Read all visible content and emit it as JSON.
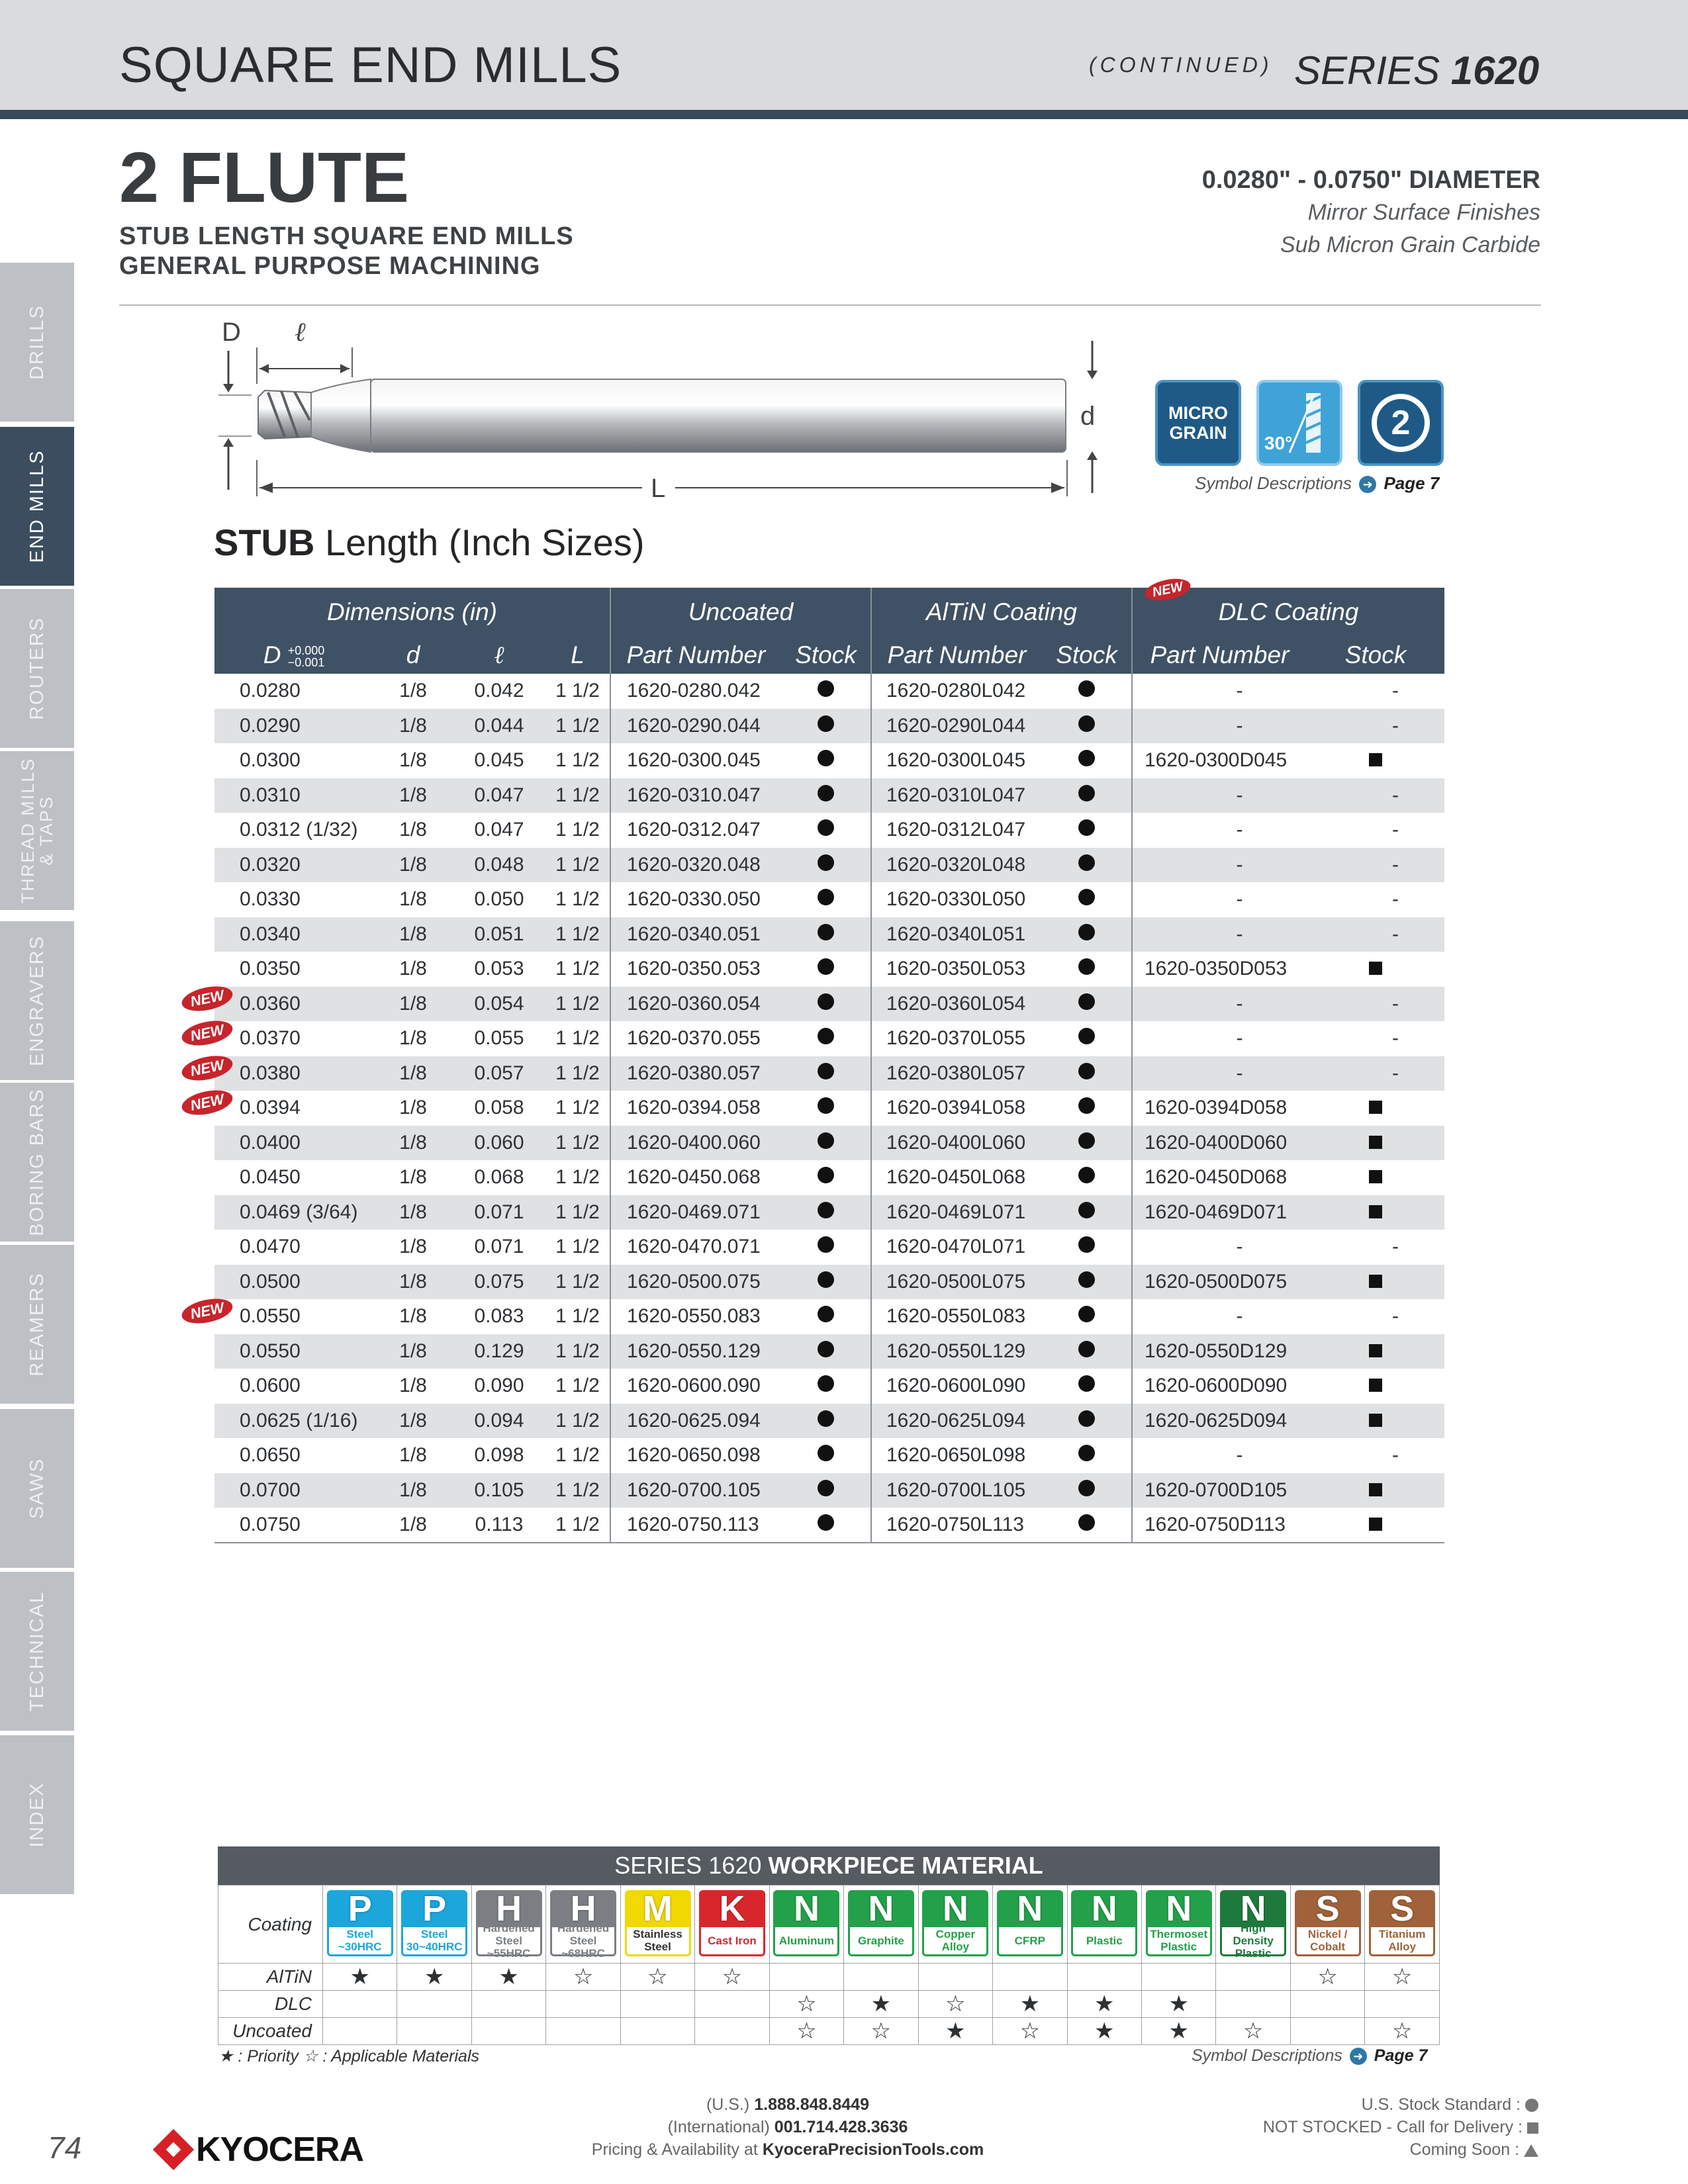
{
  "header": {
    "title": "SQUARE END MILLS",
    "continued": "(CONTINUED)",
    "series_prefix": "SERIES",
    "series_num": "1620"
  },
  "sidebar": [
    "DRILLS",
    "END MILLS",
    "ROUTERS",
    "THREAD MILLS & TAPS",
    "ENGRAVERS",
    "BORING BARS",
    "REAMERS",
    "SAWS",
    "TECHNICAL",
    "INDEX"
  ],
  "intro": {
    "flute": "2 FLUTE",
    "sub1": "STUB LENGTH SQUARE END MILLS",
    "sub2": "GENERAL PURPOSE MACHINING",
    "diameter": "0.0280\" - 0.0750\" DIAMETER",
    "finish1": "Mirror Surface Finishes",
    "finish2": "Sub Micron Grain Carbide"
  },
  "drawing": {
    "D": "D",
    "l": "ℓ",
    "d": "d",
    "L": "L"
  },
  "symbols": {
    "micro1": "MICRO",
    "micro2": "GRAIN",
    "helix": "30°",
    "flutes": "2",
    "caption": "Symbol Descriptions",
    "page": "Page 7"
  },
  "table": {
    "title_bold": "STUB",
    "title_rest": " Length (Inch Sizes)",
    "groups": {
      "dims": "Dimensions (in)",
      "uncoated": "Uncoated",
      "altin": "AlTiN Coating",
      "dlc": "DLC Coating",
      "new": "NEW"
    },
    "cols": {
      "D": "D",
      "tol_plus": "+0.000",
      "tol_minus": "−0.001",
      "d": "d",
      "l": "ℓ",
      "L": "L",
      "pn": "Part Number",
      "stock": "Stock"
    },
    "rows": [
      {
        "new": false,
        "D": "0.0280",
        "d": "1/8",
        "l": "0.042",
        "L": "1 1/2",
        "u": "1620-0280.042",
        "a": "1620-0280L042",
        "dl": "-"
      },
      {
        "new": false,
        "D": "0.0290",
        "d": "1/8",
        "l": "0.044",
        "L": "1 1/2",
        "u": "1620-0290.044",
        "a": "1620-0290L044",
        "dl": "-"
      },
      {
        "new": false,
        "D": "0.0300",
        "d": "1/8",
        "l": "0.045",
        "L": "1 1/2",
        "u": "1620-0300.045",
        "a": "1620-0300L045",
        "dl": "1620-0300D045"
      },
      {
        "new": false,
        "D": "0.0310",
        "d": "1/8",
        "l": "0.047",
        "L": "1 1/2",
        "u": "1620-0310.047",
        "a": "1620-0310L047",
        "dl": "-"
      },
      {
        "new": false,
        "D": "0.0312 (1/32)",
        "d": "1/8",
        "l": "0.047",
        "L": "1 1/2",
        "u": "1620-0312.047",
        "a": "1620-0312L047",
        "dl": "-"
      },
      {
        "new": false,
        "D": "0.0320",
        "d": "1/8",
        "l": "0.048",
        "L": "1 1/2",
        "u": "1620-0320.048",
        "a": "1620-0320L048",
        "dl": "-"
      },
      {
        "new": false,
        "D": "0.0330",
        "d": "1/8",
        "l": "0.050",
        "L": "1 1/2",
        "u": "1620-0330.050",
        "a": "1620-0330L050",
        "dl": "-"
      },
      {
        "new": false,
        "D": "0.0340",
        "d": "1/8",
        "l": "0.051",
        "L": "1 1/2",
        "u": "1620-0340.051",
        "a": "1620-0340L051",
        "dl": "-"
      },
      {
        "new": false,
        "D": "0.0350",
        "d": "1/8",
        "l": "0.053",
        "L": "1 1/2",
        "u": "1620-0350.053",
        "a": "1620-0350L053",
        "dl": "1620-0350D053"
      },
      {
        "new": true,
        "D": "0.0360",
        "d": "1/8",
        "l": "0.054",
        "L": "1 1/2",
        "u": "1620-0360.054",
        "a": "1620-0360L054",
        "dl": "-"
      },
      {
        "new": true,
        "D": "0.0370",
        "d": "1/8",
        "l": "0.055",
        "L": "1 1/2",
        "u": "1620-0370.055",
        "a": "1620-0370L055",
        "dl": "-"
      },
      {
        "new": true,
        "D": "0.0380",
        "d": "1/8",
        "l": "0.057",
        "L": "1 1/2",
        "u": "1620-0380.057",
        "a": "1620-0380L057",
        "dl": "-"
      },
      {
        "new": true,
        "D": "0.0394",
        "d": "1/8",
        "l": "0.058",
        "L": "1 1/2",
        "u": "1620-0394.058",
        "a": "1620-0394L058",
        "dl": "1620-0394D058"
      },
      {
        "new": false,
        "D": "0.0400",
        "d": "1/8",
        "l": "0.060",
        "L": "1 1/2",
        "u": "1620-0400.060",
        "a": "1620-0400L060",
        "dl": "1620-0400D060"
      },
      {
        "new": false,
        "D": "0.0450",
        "d": "1/8",
        "l": "0.068",
        "L": "1 1/2",
        "u": "1620-0450.068",
        "a": "1620-0450L068",
        "dl": "1620-0450D068"
      },
      {
        "new": false,
        "D": "0.0469 (3/64)",
        "d": "1/8",
        "l": "0.071",
        "L": "1 1/2",
        "u": "1620-0469.071",
        "a": "1620-0469L071",
        "dl": "1620-0469D071"
      },
      {
        "new": false,
        "D": "0.0470",
        "d": "1/8",
        "l": "0.071",
        "L": "1 1/2",
        "u": "1620-0470.071",
        "a": "1620-0470L071",
        "dl": "-"
      },
      {
        "new": false,
        "D": "0.0500",
        "d": "1/8",
        "l": "0.075",
        "L": "1 1/2",
        "u": "1620-0500.075",
        "a": "1620-0500L075",
        "dl": "1620-0500D075"
      },
      {
        "new": true,
        "D": "0.0550",
        "d": "1/8",
        "l": "0.083",
        "L": "1 1/2",
        "u": "1620-0550.083",
        "a": "1620-0550L083",
        "dl": "-"
      },
      {
        "new": false,
        "D": "0.0550",
        "d": "1/8",
        "l": "0.129",
        "L": "1 1/2",
        "u": "1620-0550.129",
        "a": "1620-0550L129",
        "dl": "1620-0550D129"
      },
      {
        "new": false,
        "D": "0.0600",
        "d": "1/8",
        "l": "0.090",
        "L": "1 1/2",
        "u": "1620-0600.090",
        "a": "1620-0600L090",
        "dl": "1620-0600D090"
      },
      {
        "new": false,
        "D": "0.0625 (1/16)",
        "d": "1/8",
        "l": "0.094",
        "L": "1 1/2",
        "u": "1620-0625.094",
        "a": "1620-0625L094",
        "dl": "1620-0625D094"
      },
      {
        "new": false,
        "D": "0.0650",
        "d": "1/8",
        "l": "0.098",
        "L": "1 1/2",
        "u": "1620-0650.098",
        "a": "1620-0650L098",
        "dl": "-"
      },
      {
        "new": false,
        "D": "0.0700",
        "d": "1/8",
        "l": "0.105",
        "L": "1 1/2",
        "u": "1620-0700.105",
        "a": "1620-0700L105",
        "dl": "1620-0700D105"
      },
      {
        "new": false,
        "D": "0.0750",
        "d": "1/8",
        "l": "0.113",
        "L": "1 1/2",
        "u": "1620-0750.113",
        "a": "1620-0750L113",
        "dl": "1620-0750D113"
      }
    ]
  },
  "workpiece": {
    "title_prefix": "SERIES 1620",
    "title_bold": "WORKPIECE MATERIAL",
    "coating_label": "Coating",
    "materials": [
      {
        "letter": "P",
        "text": "Steel ~30HRC",
        "color": "#1ba6dc"
      },
      {
        "letter": "P",
        "text": "Steel 30~40HRC",
        "color": "#1ba6dc"
      },
      {
        "letter": "H",
        "text": "Hardened Steel ~55HRC",
        "color": "#7b7e82"
      },
      {
        "letter": "H",
        "text": "Hardened Steel ~68HRC",
        "color": "#7b7e82"
      },
      {
        "letter": "M",
        "text": "Stainless Steel",
        "color": "#f0d800"
      },
      {
        "letter": "K",
        "text": "Cast Iron",
        "color": "#d9262c"
      },
      {
        "letter": "N",
        "text": "Aluminum",
        "color": "#23a04a"
      },
      {
        "letter": "N",
        "text": "Graphite",
        "color": "#23a04a"
      },
      {
        "letter": "N",
        "text": "Copper Alloy",
        "color": "#23a04a"
      },
      {
        "letter": "N",
        "text": "CFRP",
        "color": "#23a04a"
      },
      {
        "letter": "N",
        "text": "Plastic",
        "color": "#23a04a"
      },
      {
        "letter": "N",
        "text": "Thermoset Plastic",
        "color": "#23a04a"
      },
      {
        "letter": "N",
        "text": "High Density Plastic",
        "color": "#1e7a3c"
      },
      {
        "letter": "S",
        "text": "Nickel / Cobalt",
        "color": "#a0623a"
      },
      {
        "letter": "S",
        "text": "Titanium Alloy",
        "color": "#a0623a"
      }
    ],
    "rows": [
      {
        "name": "AlTiN",
        "marks": [
          "★",
          "★",
          "★",
          "☆",
          "☆",
          "☆",
          "",
          "",
          "",
          "",
          "",
          "",
          "",
          "☆",
          "☆"
        ]
      },
      {
        "name": "DLC",
        "marks": [
          "",
          "",
          "",
          "",
          "",
          "",
          "☆",
          "★",
          "☆",
          "★",
          "★",
          "★",
          "",
          "",
          ""
        ]
      },
      {
        "name": "Uncoated",
        "marks": [
          "",
          "",
          "",
          "",
          "",
          "",
          "☆",
          "☆",
          "★",
          "☆",
          "★",
          "★",
          "☆",
          "",
          "☆"
        ]
      }
    ],
    "legend": "★ : Priority  ☆ : Applicable Materials",
    "caption": "Symbol Descriptions",
    "page": "Page 7"
  },
  "footer": {
    "page_num": "74",
    "logo": "KYOCERA",
    "us_label": "(U.S.)",
    "us_phone": "1.888.848.8449",
    "intl_label": "(International)",
    "intl_phone": "001.714.428.3636",
    "pricing_label": "Pricing & Availability at",
    "site": "KyoceraPrecisionTools.com",
    "stock1": "U.S. Stock Standard :",
    "stock2": "NOT STOCKED - Call for Delivery :",
    "stock3": "Coming Soon :"
  }
}
